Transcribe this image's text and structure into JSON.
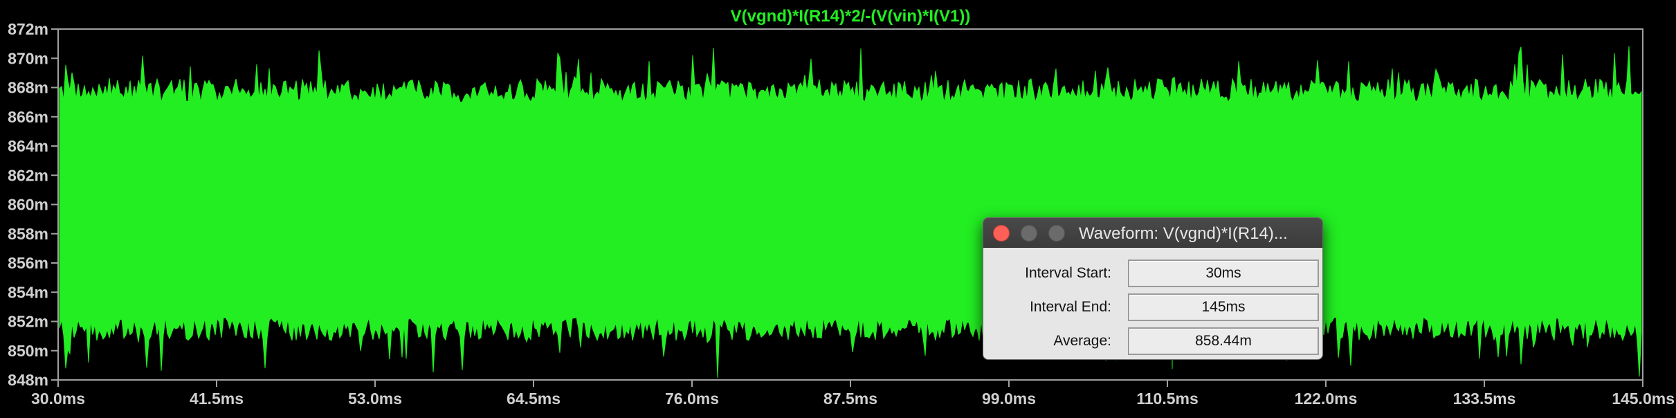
{
  "plot": {
    "trace_title": "V(vgnd)*I(R14)*2/-(V(vin)*I(V1))",
    "y_ticks": [
      "872m",
      "870m",
      "868m",
      "866m",
      "864m",
      "862m",
      "860m",
      "858m",
      "856m",
      "854m",
      "852m",
      "850m",
      "848m"
    ],
    "x_ticks": [
      "30.0ms",
      "41.5ms",
      "53.0ms",
      "64.5ms",
      "76.0ms",
      "87.5ms",
      "99.0ms",
      "110.5ms",
      "122.0ms",
      "133.5ms",
      "145.0ms"
    ],
    "colors": {
      "background": "#000000",
      "trace": "#22ee22",
      "axis": "#a0a0a0",
      "labels": "#d0d0d0"
    }
  },
  "chart_data": {
    "type": "area",
    "title": "V(vgnd)*I(R14)*2/-(V(vin)*I(V1))",
    "xlabel": "",
    "ylabel": "",
    "x_unit": "ms",
    "y_unit": "m",
    "xlim": [
      30.0,
      145.0
    ],
    "ylim": [
      848,
      872
    ],
    "band": {
      "upper": 867.8,
      "upper_peak": 870.3,
      "lower": 851.5,
      "lower_peak": 848.6
    },
    "x_ticks": [
      30.0,
      41.5,
      53.0,
      64.5,
      76.0,
      87.5,
      99.0,
      110.5,
      122.0,
      133.5,
      145.0
    ],
    "y_ticks": [
      848,
      850,
      852,
      854,
      856,
      858,
      860,
      862,
      864,
      866,
      868,
      870,
      872
    ],
    "grid": false,
    "legend": "none"
  },
  "dialog": {
    "title": "Waveform: V(vgnd)*I(R14)...",
    "rows": [
      {
        "label": "Interval Start:",
        "value": "30ms"
      },
      {
        "label": "Interval End:",
        "value": "145ms"
      },
      {
        "label": "Average:",
        "value": "858.44m"
      }
    ]
  }
}
